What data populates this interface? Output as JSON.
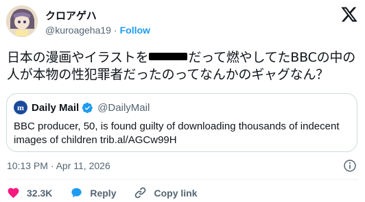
{
  "author": {
    "name": "クロアゲハ",
    "handle": "@kuroageha19",
    "separator": "·",
    "follow_label": "Follow"
  },
  "tweet": {
    "text_part1": "日本の漫画やイラストを",
    "text_part2": "だって燃やしてたBBCの中の人が本物の性犯罪者だったのってなんかのギャグなん？"
  },
  "quote": {
    "source_name": "Daily Mail",
    "source_handle": "@DailyMail",
    "logo_letter": "m",
    "text": "BBC producer, 50, is found guilty of downloading thousands of indecent images of children trib.al/AGCw99H"
  },
  "meta": {
    "timestamp": "10:13 PM · Apr 11, 2026"
  },
  "actions": {
    "like_count": "32.3K",
    "reply_label": "Reply",
    "copy_link_label": "Copy link"
  },
  "colors": {
    "accent": "#1d9bf0",
    "like": "#f91880",
    "verified": "#1d9bf0"
  }
}
